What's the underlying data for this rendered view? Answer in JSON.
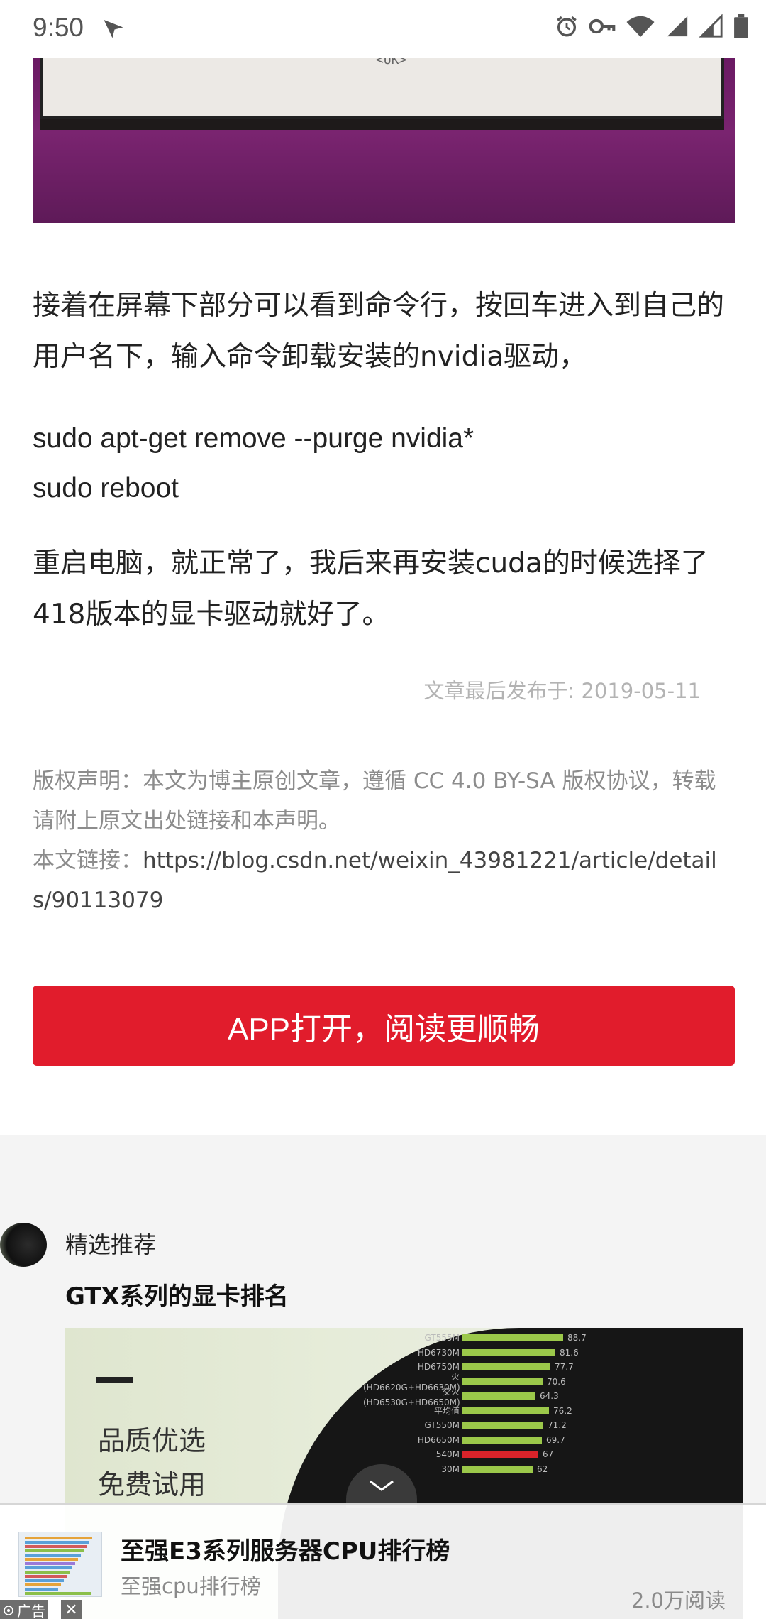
{
  "status_bar": {
    "time": "9:50"
  },
  "hero": {
    "screen_text": "<UK>"
  },
  "article": {
    "paragraph1": "接着在屏幕下部分可以看到命令行，按回车进入到自己的用户名下，输入命令卸载安装的nvidia驱动，",
    "code_line1": "sudo apt-get remove --purge nvidia*",
    "code_line2": "sudo reboot",
    "paragraph2": "重启电脑，就正常了，我后来再安装cuda的时候选择了418版本的显卡驱动就好了。",
    "pubdate": "文章最后发布于: 2019-05-11"
  },
  "copyright": {
    "statement": "版权声明：本文为博主原创文章，遵循 CC 4.0 BY-SA 版权协议，转载请附上原文出处链接和本声明。",
    "link_label": "本文链接：",
    "link_url": "https://blog.csdn.net/weixin_43981221/article/details/90113079"
  },
  "app_button": {
    "label": "APP打开，阅读更顺畅"
  },
  "recommend": {
    "label": "精选推荐",
    "title": "GTX系列的显卡排名",
    "image_text1": "品质优选",
    "image_text2": "免费试用",
    "bars": [
      {
        "name": "GT555M",
        "value": "88.7"
      },
      {
        "name": "HD6730M",
        "value": "81.6"
      },
      {
        "name": "HD6750M",
        "value": "77.7"
      },
      {
        "name": "火(HD6620G+HD6630M)",
        "value": "70.6"
      },
      {
        "name": "交火(HD6530G+HD6650M)",
        "value": "64.3"
      },
      {
        "name": "平均值",
        "value": "76.2"
      },
      {
        "name": "GT550M",
        "value": "71.2"
      },
      {
        "name": "HD6650M",
        "value": "69.7"
      },
      {
        "name": "540M",
        "value": "67"
      },
      {
        "name": "30M",
        "value": "62"
      }
    ]
  },
  "ad": {
    "title": "至强E3系列服务器CPU排行榜",
    "subtitle": "至强cpu排行榜",
    "reads": "2.0万阅读",
    "tag": "广告"
  },
  "colors": {
    "accent_red": "#e11c2c",
    "bar_green": "#9bc84a",
    "bar_red": "#d9232a"
  }
}
